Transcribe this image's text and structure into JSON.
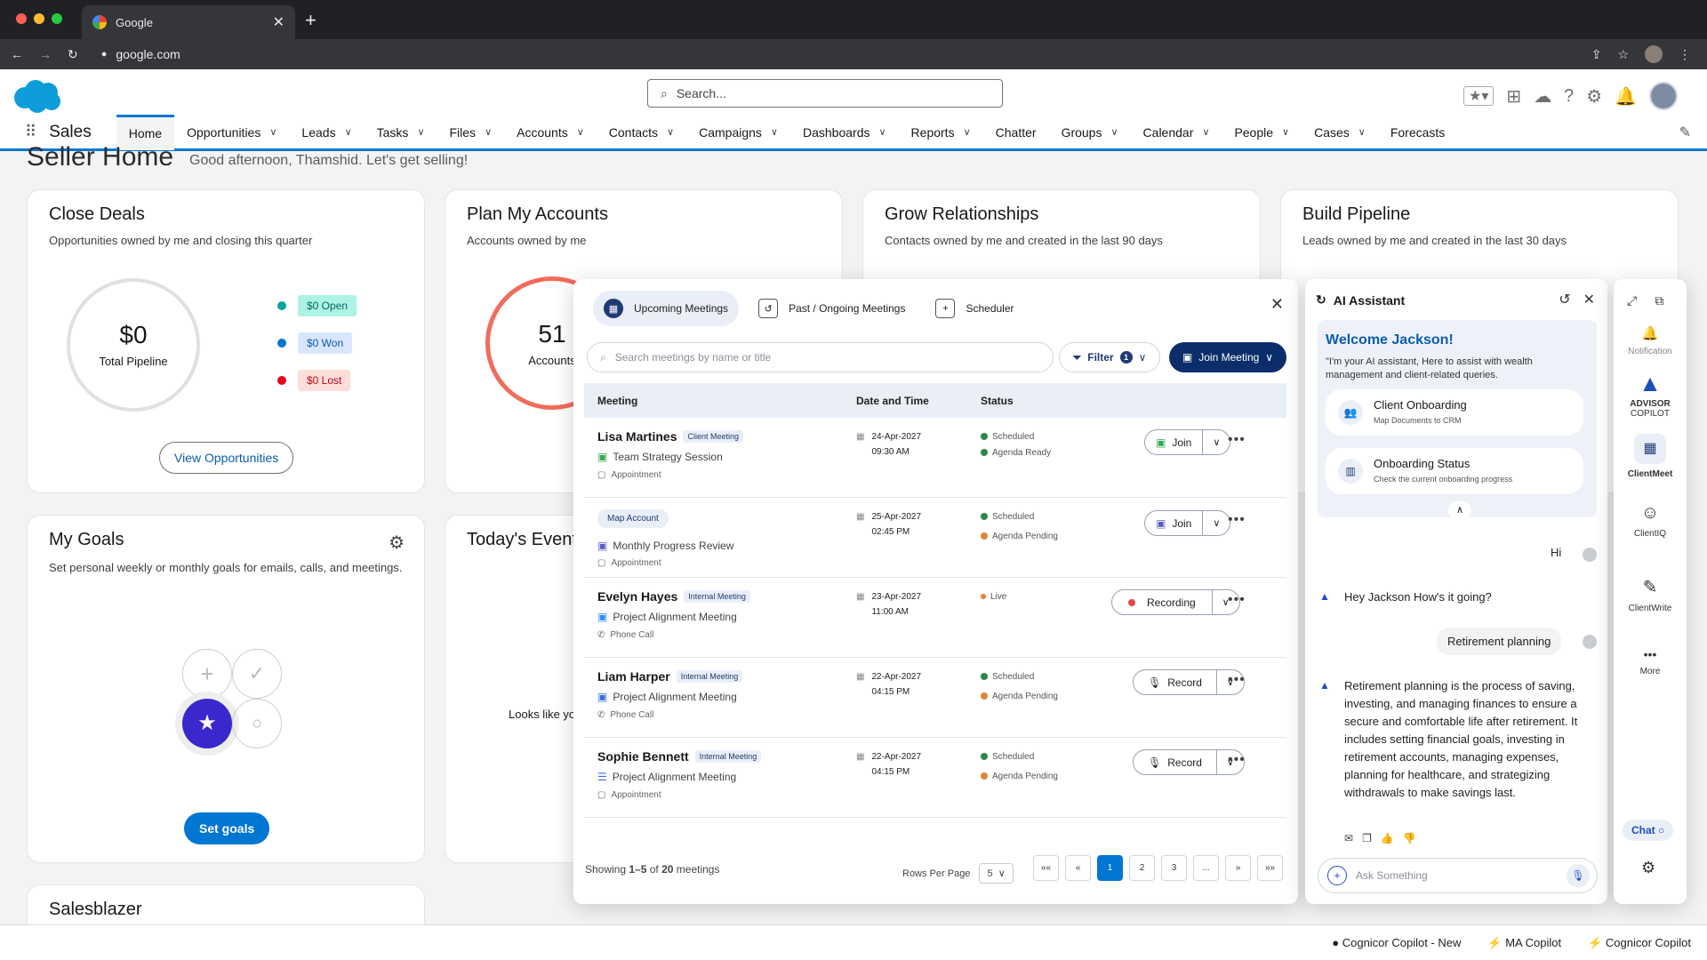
{
  "browser": {
    "tab_title": "Google",
    "url": "google.com"
  },
  "sf": {
    "search_placeholder": "Search...",
    "app_name": "Sales",
    "nav": [
      "Home",
      "Opportunities",
      "Leads",
      "Tasks",
      "Files",
      "Accounts",
      "Contacts",
      "Campaigns",
      "Dashboards",
      "Reports",
      "Chatter",
      "Groups",
      "Calendar",
      "People",
      "Cases",
      "Forecasts"
    ],
    "page_title": "Seller Home",
    "greeting": "Good afternoon, Thamshid. Let's get selling!"
  },
  "cards": {
    "close_deals": {
      "title": "Close Deals",
      "sub": "Opportunities owned by me and closing this quarter",
      "value": "$0",
      "value_label": "Total Pipeline",
      "open": "$0 Open",
      "won": "$0 Won",
      "lost": "$0 Lost",
      "button": "View Opportunities"
    },
    "plan_accounts": {
      "title": "Plan My Accounts",
      "sub": "Accounts owned by me",
      "value": "51",
      "value_label": "Accounts"
    },
    "grow": {
      "title": "Grow Relationships",
      "sub": "Contacts owned by me and created in the last 90 days"
    },
    "pipeline": {
      "title": "Build Pipeline",
      "sub": "Leads owned by me and created in the last 30 days"
    },
    "goals": {
      "title": "My Goals",
      "sub": "Set personal weekly or monthly goals for emails, calls, and meetings.",
      "button": "Set goals"
    },
    "events": {
      "title": "Today's Events",
      "empty": "Looks like yo"
    },
    "salesblazer": {
      "title": "Salesblazer"
    }
  },
  "meetings": {
    "tabs": [
      "Upcoming Meetings",
      "Past / Ongoing Meetings",
      "Scheduler"
    ],
    "search_placeholder": "Search meetings by name or title",
    "filter_label": "Filter",
    "filter_count": "1",
    "join_label": "Join Meeting",
    "columns": [
      "Meeting",
      "Date and Time",
      "Status"
    ],
    "rows": [
      {
        "name": "Lisa Martines",
        "tag": "Client Meeting",
        "title": "Team Strategy Session",
        "type": "Appointment",
        "date": "24-Apr-2027",
        "time": "09:30 AM",
        "status1": "Scheduled",
        "status2": "Agenda Ready",
        "action": "Join"
      },
      {
        "name": "",
        "tag": "Map Account",
        "title": "Monthly Progress Review",
        "type": "Appointment",
        "date": "25-Apr-2027",
        "time": "02:45 PM",
        "status1": "Scheduled",
        "status2": "Agenda Pending",
        "action": "Join"
      },
      {
        "name": "Evelyn Hayes",
        "tag": "Internal Meeting",
        "title": "Project Alignment Meeting",
        "type": "Phone Call",
        "date": "23-Apr-2027",
        "time": "11:00 AM",
        "status1": "Live",
        "status2": "",
        "action": "Recording"
      },
      {
        "name": "Liam Harper",
        "tag": "Internal Meeting",
        "title": "Project Alignment Meeting",
        "type": "Phone Call",
        "date": "22-Apr-2027",
        "time": "04:15 PM",
        "status1": "Scheduled",
        "status2": "Agenda Pending",
        "action": "Record"
      },
      {
        "name": "Sophie Bennett",
        "tag": "Internal Meeting",
        "title": "Project Alignment Meeting",
        "type": "Appointment",
        "date": "22-Apr-2027",
        "time": "04:15 PM",
        "status1": "Scheduled",
        "status2": "Agenda Pending",
        "action": "Record"
      }
    ],
    "showing_prefix": "Showing ",
    "showing_range": "1–5",
    "showing_of": " of ",
    "showing_total": "20",
    "showing_suffix": " meetings",
    "rows_per_page_label": "Rows Per Page",
    "rows_per_page": "5",
    "pages": [
      "««",
      "«",
      "1",
      "2",
      "3",
      "...",
      "»",
      "»»"
    ]
  },
  "ai": {
    "title": "AI Assistant",
    "welcome_title": "Welcome Jackson!",
    "welcome_text": "\"I'm your AI assistant, Here to assist with wealth management and client-related queries.",
    "suggestions": [
      {
        "title": "Client Onboarding",
        "sub": "Map Documents to CRM"
      },
      {
        "title": "Onboarding Status",
        "sub": "Check the current onboarding progress"
      }
    ],
    "msg_user1": "Hi",
    "msg_bot1": "Hey Jackson How's it going?",
    "msg_user2": "Retirement planning",
    "msg_bot2": "Retirement planning is the process of saving, investing, and managing finances to ensure a secure and comfortable life after retirement. It includes setting financial goals, investing in retirement accounts, managing expenses, planning for healthcare, and strategizing withdrawals to make savings last.",
    "input_placeholder": "Ask Something"
  },
  "rail": {
    "notification": "Notification",
    "brand1": "ADVISOR",
    "brand2": "COPILOT",
    "clientmeet": "ClientMeet",
    "clientiq": "ClientIQ",
    "clientwrite": "ClientWrite",
    "more": "More",
    "chat": "Chat"
  },
  "footer": [
    "Cognicor Copilot - New",
    "MA Copilot",
    "Cognicor Copilot"
  ]
}
